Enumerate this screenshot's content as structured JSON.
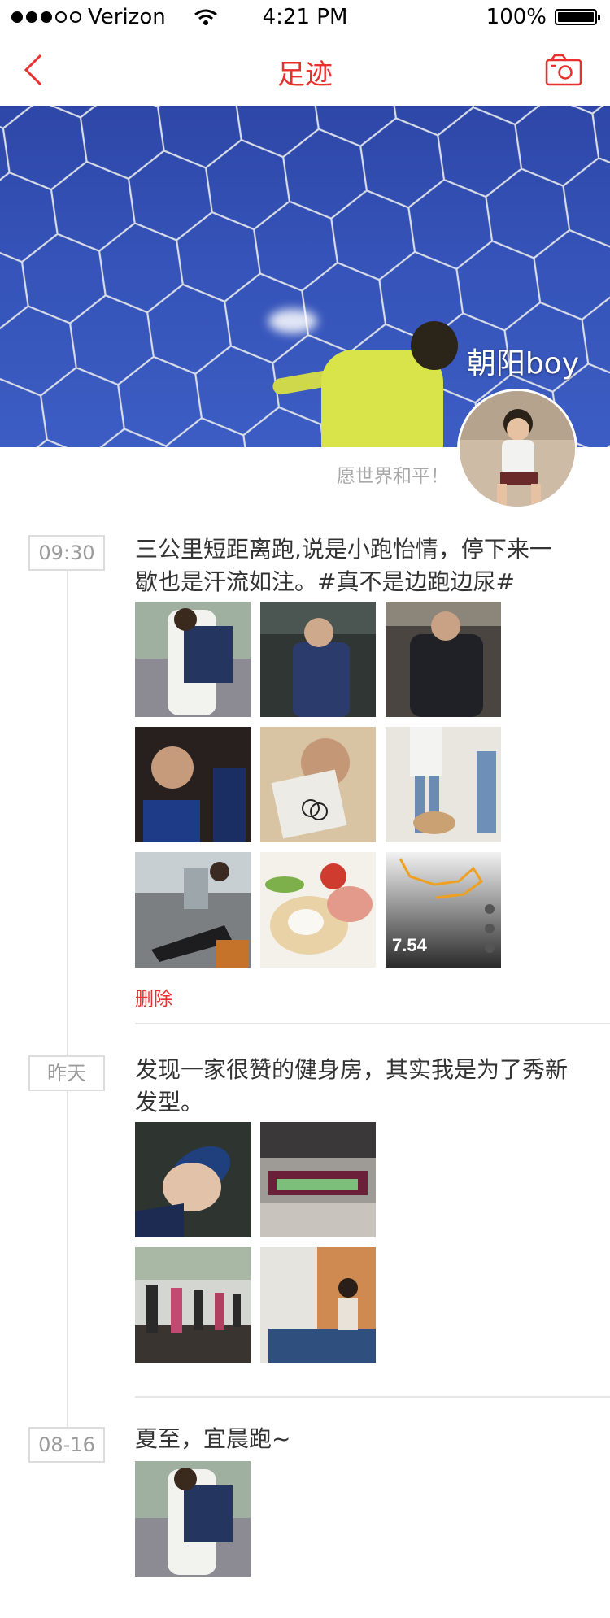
{
  "status_bar": {
    "carrier": "Verizon",
    "time": "4:21 PM",
    "battery": "100%"
  },
  "nav": {
    "title": "足迹",
    "back_icon": "chevron-left-icon",
    "camera_icon": "camera-icon"
  },
  "profile": {
    "username": "朝阳boy",
    "motto": "愿世界和平！"
  },
  "entries": [
    {
      "date": "09:30",
      "text": "三公里短距离跑,说是小跑怡情，停下来一歇也是汗流如注。#真不是边跑边尿#",
      "delete_label": "删除",
      "photo_count": 9,
      "run_stat": "7.54"
    },
    {
      "date": "昨天",
      "text": "发现一家很赞的健身房，其实我是为了秀新发型。",
      "photo_count": 4
    },
    {
      "date": "08-16",
      "text": "夏至，宜晨跑~",
      "photo_count": 1
    }
  ],
  "colors": {
    "accent": "#e8312e",
    "date_tag_border": "#dcdcdc",
    "timeline": "#e3e3e3",
    "cover_sky": "#3553b8"
  }
}
